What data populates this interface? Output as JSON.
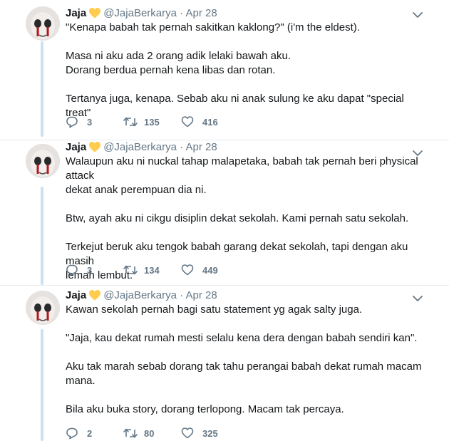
{
  "tweets": [
    {
      "name": "Jaja",
      "handle": "@JajaBerkarya",
      "dot": "·",
      "date": "Apr 28",
      "paragraphs": [
        "\"Kenapa babah tak pernah sakitkan kaklong?\" (i'm the eldest).",
        "Masa ni aku ada 2 orang adik lelaki bawah aku.\nDorang berdua pernah kena libas dan rotan.",
        "Tertanya juga, kenapa. Sebab aku ni anak sulung ke aku dapat \"special treat\""
      ],
      "replies": "3",
      "retweets": "135",
      "likes": "416"
    },
    {
      "name": "Jaja",
      "handle": "@JajaBerkarya",
      "dot": "·",
      "date": "Apr 28",
      "paragraphs": [
        "Walaupun aku ni nuckal tahap malapetaka, babah tak pernah beri physical attack\ndekat anak perempuan dia ni.",
        "Btw, ayah aku ni cikgu disiplin dekat sekolah. Kami pernah satu sekolah.",
        "Terkejut beruk aku tengok babah garang dekat sekolah, tapi dengan aku masih\nlemah lembut."
      ],
      "replies": "3",
      "retweets": "134",
      "likes": "449"
    },
    {
      "name": "Jaja",
      "handle": "@JajaBerkarya",
      "dot": "·",
      "date": "Apr 28",
      "paragraphs": [
        "Kawan sekolah pernah bagi satu statement yg agak salty juga.",
        "\"Jaja, kau dekat rumah mesti selalu kena dera dengan babah sendiri kan\".",
        "Aku tak marah sebab dorang tak tahu perangai babah dekat rumah macam\nmana.",
        "Bila aku buka story, dorang terlopong. Macam tak percaya."
      ],
      "replies": "2",
      "retweets": "80",
      "likes": "325"
    }
  ],
  "icons": {
    "verified_heart": "yellow-heart-icon",
    "more": "chevron-down-icon",
    "reply": "reply-icon",
    "retweet": "retweet-icon",
    "like": "heart-icon"
  },
  "colors": {
    "text": "#14171a",
    "muted": "#657786",
    "thread_line": "#cde0ef",
    "heart_emoji": "#ffcc4d",
    "divider": "#e6ecf0"
  }
}
